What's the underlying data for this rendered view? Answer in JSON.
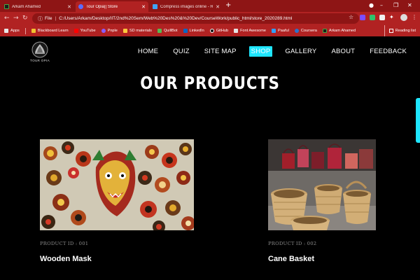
{
  "browser": {
    "tabs": [
      {
        "title": "Arkam Ahamed",
        "favicon_color": "#1c1c1c"
      },
      {
        "title": "Tour Opia|| Store",
        "favicon_color": "#5b6cff"
      },
      {
        "title": "Compress images online - Redu",
        "favicon_color": "#3fa2f7"
      }
    ],
    "address": {
      "scheme_label": "File",
      "url": "C:/Users/Arkam/Desktop/IIT/2nd%20Sem/Web%20Des%20&%20Dev/CourseWork/public_html/store_2020289.html"
    },
    "bookmarks": [
      {
        "label": "Apps",
        "icon_color": "#e8e8e8"
      },
      {
        "label": "Blackboard Learn",
        "icon_color": "#333333"
      },
      {
        "label": "YouTube",
        "icon_color": "#ff0000"
      },
      {
        "label": "Pnple",
        "icon_color": "#8a5cff"
      },
      {
        "label": "SD materials",
        "icon_color": "#ffc83d"
      },
      {
        "label": "QuillBot",
        "icon_color": "#59b852"
      },
      {
        "label": "LinkedIn",
        "icon_color": "#0a66c2"
      },
      {
        "label": "GitHub",
        "icon_color": "#111111"
      },
      {
        "label": "Font Awesome",
        "icon_color": "#e6e6e6"
      },
      {
        "label": "Paaful",
        "icon_color": "#2fa0ff"
      },
      {
        "label": "Coursera",
        "icon_color": "#2a73cc"
      },
      {
        "label": "Arkam Ahamed",
        "icon_color": "#1c1c1c"
      }
    ],
    "reading_list": "Reading list"
  },
  "site": {
    "logo_text": "TOUR OPIA",
    "nav": [
      {
        "label": "HOME",
        "active": false
      },
      {
        "label": "QUIZ",
        "active": false
      },
      {
        "label": "SITE MAP",
        "active": false
      },
      {
        "label": "SHOP",
        "active": true
      },
      {
        "label": "GALLERY",
        "active": false
      },
      {
        "label": "ABOUT",
        "active": false
      },
      {
        "label": "FEEDBACK",
        "active": false
      }
    ],
    "accent": "#1fe6ff",
    "page_title": "OUR PRODUCTS",
    "products": [
      {
        "id_label": "PRODUCT ID : 001",
        "name": "Wooden Mask",
        "image": "wooden-masks-photo"
      },
      {
        "id_label": "PRODUCT ID : 002",
        "name": "Cane Basket",
        "image": "cane-baskets-photo"
      }
    ]
  }
}
